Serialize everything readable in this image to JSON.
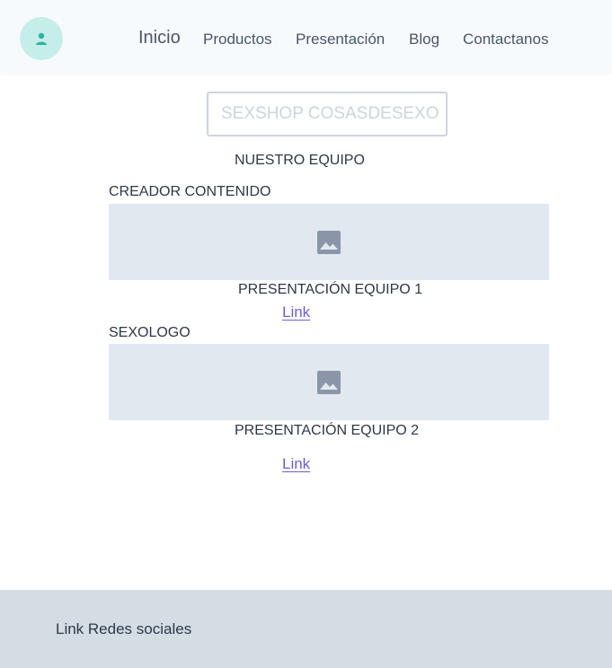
{
  "header": {
    "nav": [
      "Inicio",
      "Productos",
      "Presentación",
      "Blog",
      "Contactanos"
    ]
  },
  "search": {
    "placeholder": "SEXSHOP COSASDESEXO"
  },
  "team": {
    "title": "NUESTRO EQUIPO",
    "members": [
      {
        "role": "CREADOR CONTENIDO",
        "presentation": "PRESENTACIÓN EQUIPO 1",
        "link": "Link"
      },
      {
        "role": "SEXOLOGO",
        "presentation": "PRESENTACIÓN EQUIPO 2",
        "link": "Link"
      }
    ]
  },
  "footer": {
    "text": "Link Redes sociales"
  },
  "colors": {
    "accent": "#2bb3a3",
    "avatar_bg": "#c6eee9",
    "link": "#6b5fd6",
    "footer_bg": "#d5dde4",
    "placeholder_bg": "#e2e8f0"
  },
  "icons": [
    "user-icon",
    "image-icon"
  ]
}
